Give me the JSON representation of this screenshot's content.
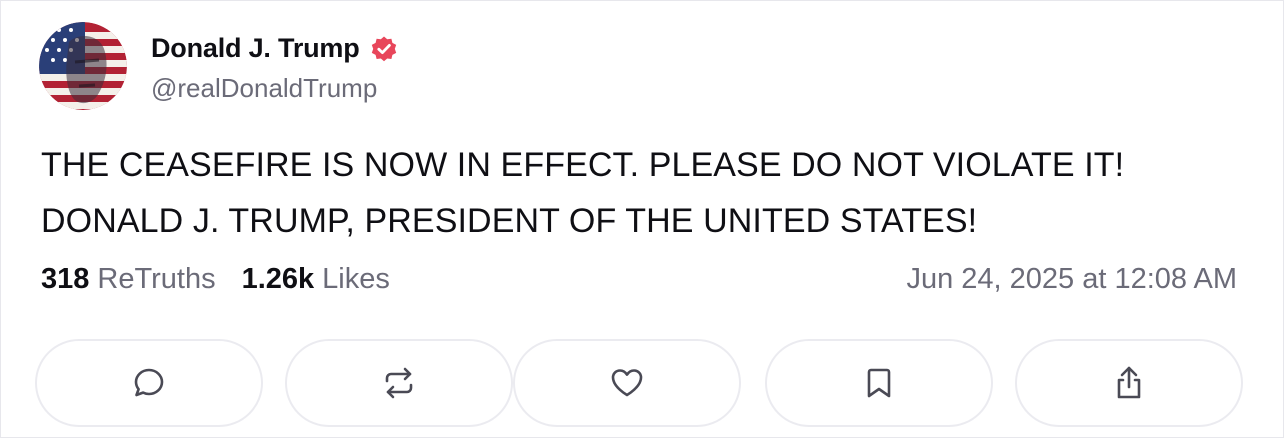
{
  "author": {
    "display_name": "Donald J. Trump",
    "handle": "@realDonaldTrump",
    "verified": true,
    "verified_badge_color": "#e8465b"
  },
  "post": {
    "lines": [
      "THE CEASEFIRE IS NOW IN EFFECT. PLEASE DO NOT VIOLATE IT!",
      "DONALD J. TRUMP, PRESIDENT OF THE UNITED STATES!"
    ]
  },
  "stats": {
    "retruths_count": "318",
    "retruths_label": "ReTruths",
    "likes_count": "1.26k",
    "likes_label": "Likes"
  },
  "timestamp": "Jun 24, 2025 at 12:08 AM",
  "actions": [
    {
      "icon": "reply-icon"
    },
    {
      "icon": "retruth-icon"
    },
    {
      "icon": "like-icon"
    },
    {
      "icon": "bookmark-icon"
    },
    {
      "icon": "share-icon"
    }
  ]
}
